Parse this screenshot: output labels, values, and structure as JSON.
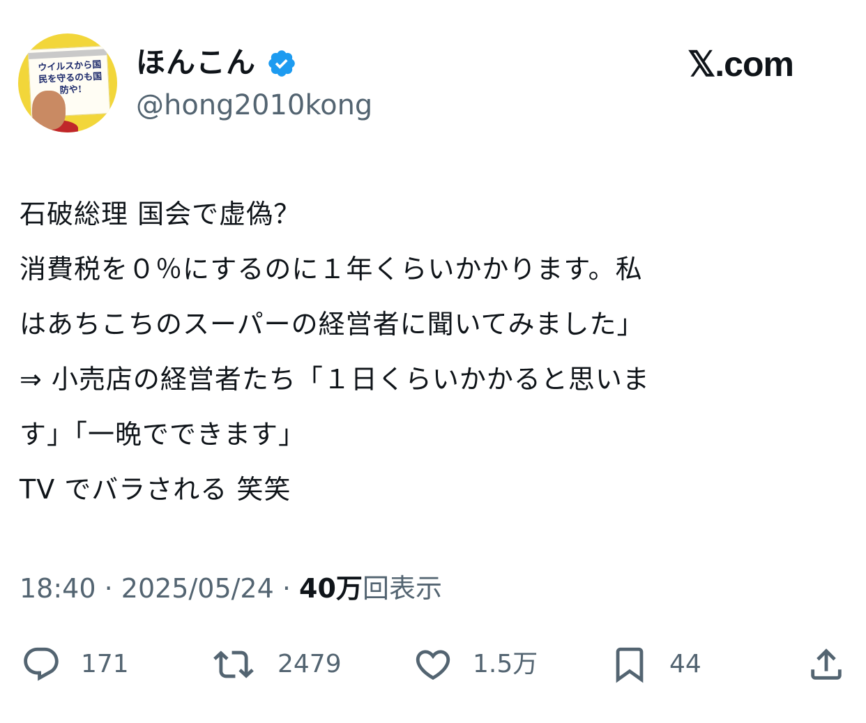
{
  "header": {
    "avatar_cover_title": "ウイルスから国民を守るのも国防や!",
    "display_name": "ほんこん",
    "handle": "@hong2010kong",
    "brand": "𝕏.com",
    "verified_badge_color": "#1d9bf0"
  },
  "tweet": {
    "lines": [
      "石破総理 国会で虚偽？",
      "消費税を０％にするのに１年くらいかかります。私",
      "はあちこちのスーパーの経営者に聞いてみました」",
      "⇒ 小売店の経営者たち「１日くらいかかると思いま",
      "す」「一晩でできます」",
      "TV でバラされる 笑笑"
    ]
  },
  "meta": {
    "time": "18:40",
    "separator": " · ",
    "date": "2025/05/24",
    "views_count": "40万",
    "views_label": "回表示"
  },
  "actions": {
    "replies": {
      "icon": "reply-icon",
      "count": "171"
    },
    "retweets": {
      "icon": "retweet-icon",
      "count": "2479"
    },
    "likes": {
      "icon": "heart-icon",
      "count": "1.5万"
    },
    "bookmarks": {
      "icon": "bookmark-icon",
      "count": "44"
    },
    "share": {
      "icon": "share-icon"
    }
  },
  "colors": {
    "text_primary": "#0f1419",
    "text_secondary": "#536471",
    "verified": "#1d9bf0"
  }
}
